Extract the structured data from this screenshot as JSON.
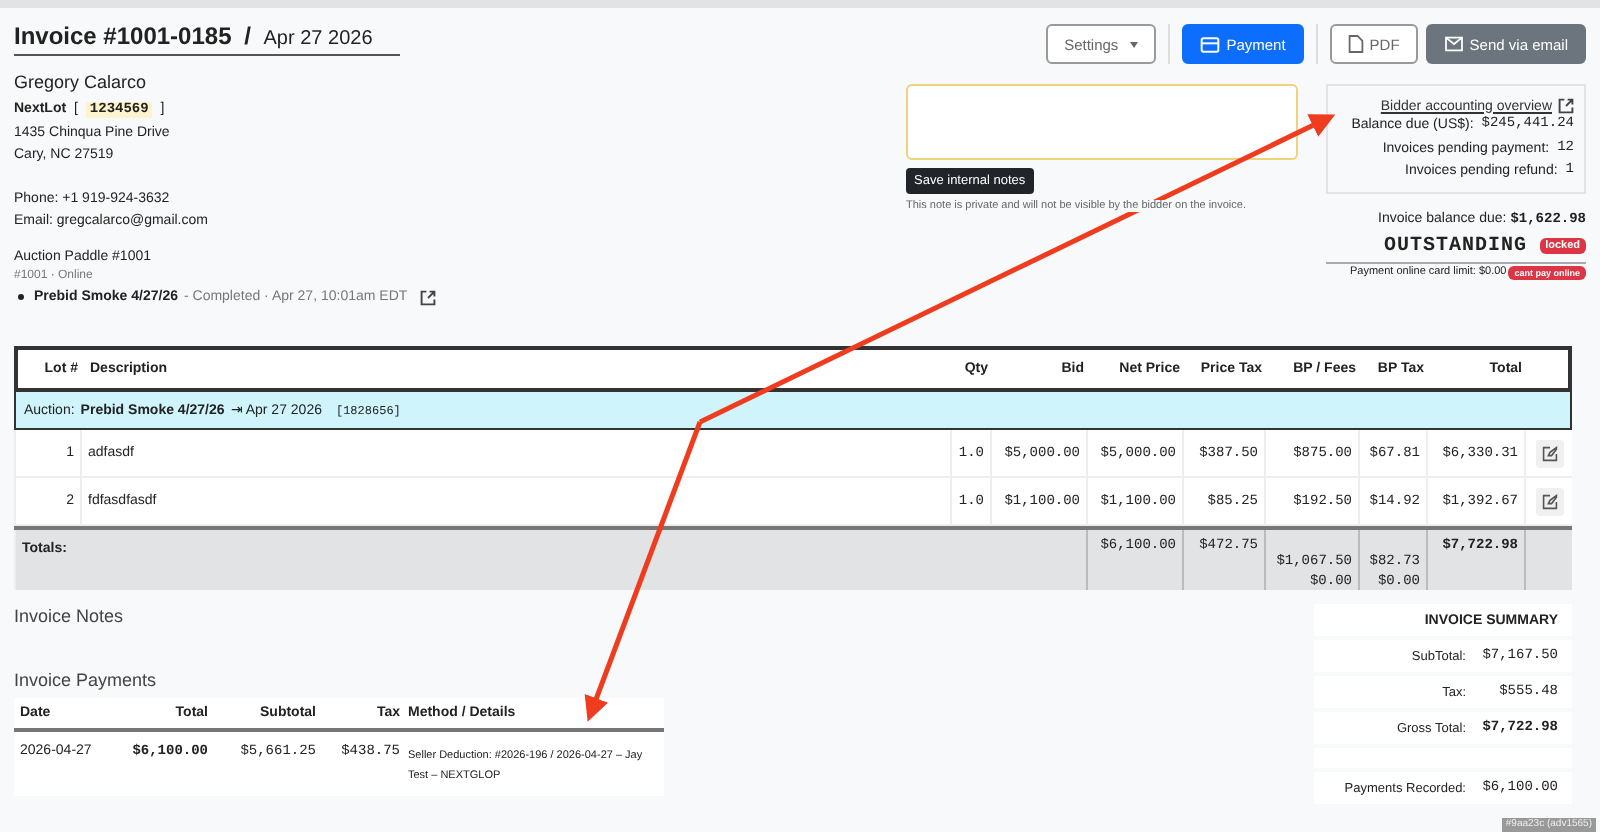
{
  "header": {
    "title": "Invoice #1001-0185",
    "separator": "/",
    "date": "Apr 27 2026"
  },
  "buttons": [
    {
      "label": "Settings",
      "kind": "dropdown"
    },
    {
      "label": "Payment",
      "kind": "primary"
    },
    {
      "label": "PDF",
      "kind": "outline"
    },
    {
      "label": "Send via email",
      "kind": "dark"
    }
  ],
  "bidder": {
    "name": "Gregory Calarco",
    "company": "NextLot",
    "bracket_open": "[",
    "bidder_id": "1234569",
    "bracket_close": "]",
    "address": [
      "1435 Chinqua Pine Drive",
      "Cary, NC 27519"
    ],
    "phone": "Phone: +1 919-924-3632",
    "email": "Email: gregcalarco@gmail.com",
    "paddle": "Auction Paddle #1001",
    "paddle_meta": "#1001 · Online",
    "auction": {
      "name": "Prebid Smoke 4/27/26",
      "status": "- Completed · Apr 27, 10:01am EDT"
    }
  },
  "notes": {
    "button": "Save internal notes",
    "hint": "This note is private and will not be visible by the bidder on the invoice."
  },
  "accounting": {
    "link": "Bidder accounting overview",
    "rows": [
      {
        "label": "Balance due (US$):",
        "value": "$245,441.24"
      },
      {
        "label": "Invoices pending payment:",
        "value": "12"
      },
      {
        "label": "Invoices pending refund:",
        "value": "1"
      }
    ]
  },
  "balance": {
    "label": "Invoice balance due:",
    "value": "$1,622.98",
    "status": "OUTSTANDING",
    "status_badge": "locked",
    "card_limit": "Payment online card limit: $0.00",
    "card_badge": "cant pay online"
  },
  "table": {
    "columns": [
      "Lot #",
      "Description",
      "Qty",
      "Bid",
      "Net Price",
      "Price Tax",
      "BP / Fees",
      "BP Tax",
      "Total"
    ],
    "auction_row": {
      "label": "Auction:",
      "name": "Prebid Smoke 4/27/26",
      "arrow": "⇥",
      "date": "Apr 27 2026",
      "id": "[1828656]"
    },
    "rows": [
      {
        "lot": "1",
        "description": "adfasdf",
        "qty": "1.0",
        "bid": "$5,000.00",
        "net": "$5,000.00",
        "price_tax": "$387.50",
        "bp": "$875.00",
        "bp_tax": "$67.81",
        "total": "$6,330.31"
      },
      {
        "lot": "2",
        "description": "fdfasdfasdf",
        "qty": "1.0",
        "bid": "$1,100.00",
        "net": "$1,100.00",
        "price_tax": "$85.25",
        "bp": "$192.50",
        "bp_tax": "$14.92",
        "total": "$1,392.67"
      }
    ],
    "totals": {
      "label": "Totals:",
      "net": "$6,100.00",
      "price_tax": "$472.75",
      "bp": [
        "$1,067.50",
        "$0.00"
      ],
      "bp_tax": [
        "$82.73",
        "$0.00"
      ],
      "total": "$7,722.98"
    }
  },
  "invoice_notes": {
    "title": "Invoice Notes"
  },
  "payments": {
    "title": "Invoice Payments",
    "columns": [
      "Date",
      "Total",
      "Subtotal",
      "Tax",
      "Method / Details"
    ],
    "rows": [
      {
        "date": "2026-04-27",
        "total": "$6,100.00",
        "subtotal": "$5,661.25",
        "tax": "$438.75",
        "details": "Seller Deduction: #2026-196 / 2026-04-27 – Jay Test – NEXTGLOP"
      }
    ]
  },
  "summary": {
    "title": "INVOICE SUMMARY",
    "rows": [
      {
        "label": "SubTotal:",
        "value": "$7,167.50",
        "bold": false
      },
      {
        "label": "Tax:",
        "value": "$555.48",
        "bold": false
      },
      {
        "label": "Gross Total:",
        "value": "$7,722.98",
        "bold": true
      },
      {
        "label": "Payments Recorded:",
        "value": "$6,100.00",
        "bold": false
      }
    ]
  },
  "build_tag": "#9aa23c (adv1565)"
}
